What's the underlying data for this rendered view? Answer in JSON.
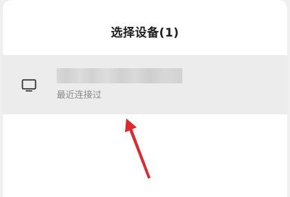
{
  "dialog": {
    "title": "选择设备(1)"
  },
  "device": {
    "icon": "tv-icon",
    "name": "",
    "status": "最近连接过"
  },
  "annotation": {
    "icon": "red-arrow-pointer",
    "color": "#e0282c"
  }
}
